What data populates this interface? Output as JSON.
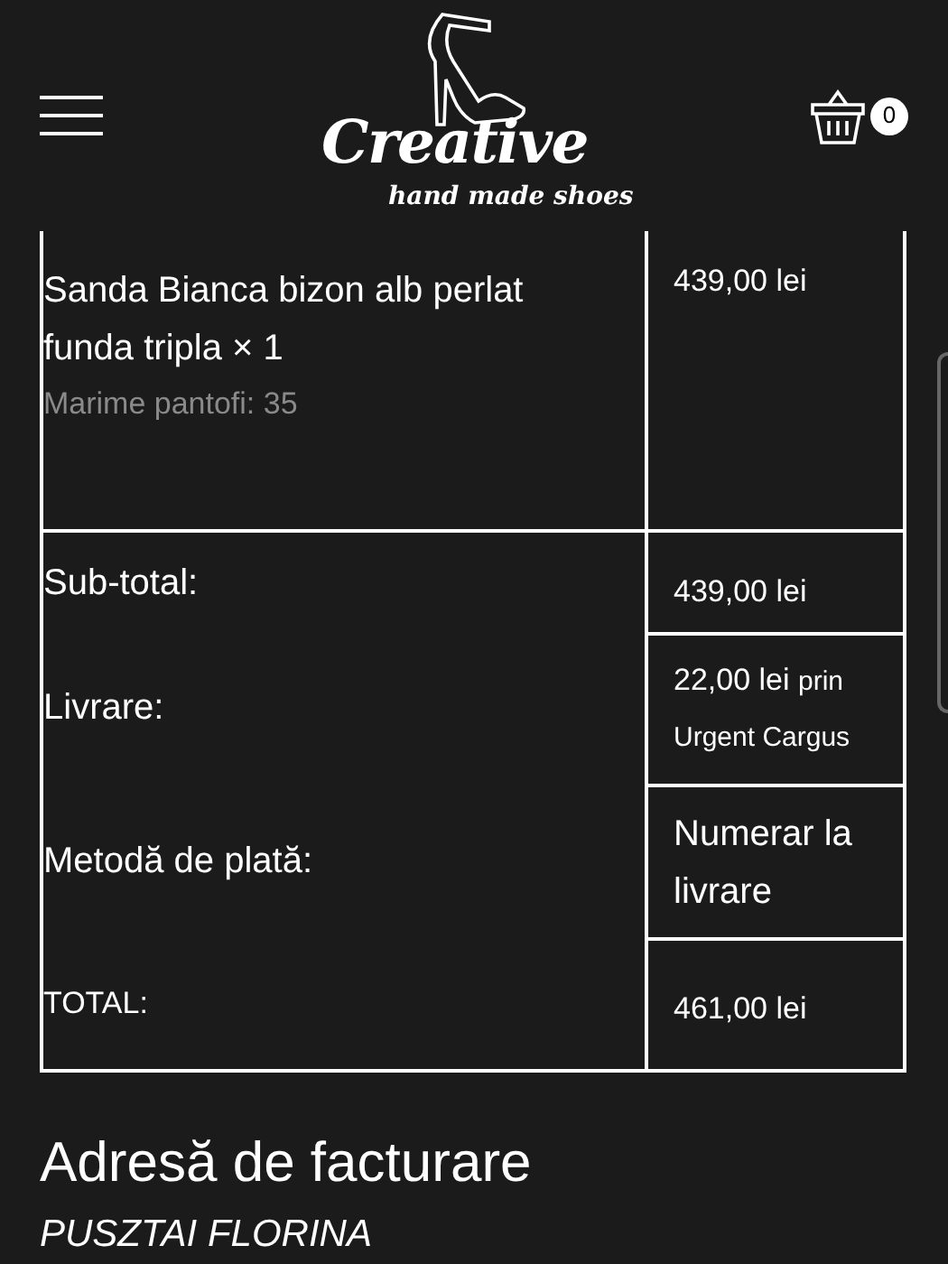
{
  "header": {
    "logo": {
      "title": "Creative",
      "tagline": "hand made shoes"
    },
    "cart": {
      "count": "0"
    }
  },
  "order_table": {
    "item": {
      "name": "Sanda Bianca bizon alb perlat funda tripla × 1",
      "meta": "Marime pantofi: 35",
      "price": "439,00 lei"
    },
    "totals": [
      {
        "kind": "subtotal",
        "label": "Sub-total:",
        "value": "439,00 lei"
      },
      {
        "kind": "shipping",
        "label": "Livrare:",
        "value": "22,00 lei",
        "note": "prin Urgent Cargus"
      },
      {
        "kind": "payment",
        "label": "Metodă de plată:",
        "value": "Numerar la livrare"
      },
      {
        "kind": "total",
        "label": "TOTAL:",
        "value": "461,00 lei"
      }
    ]
  },
  "billing": {
    "heading": "Adresă de facturare",
    "name": "PUSZTAI FLORINA"
  }
}
